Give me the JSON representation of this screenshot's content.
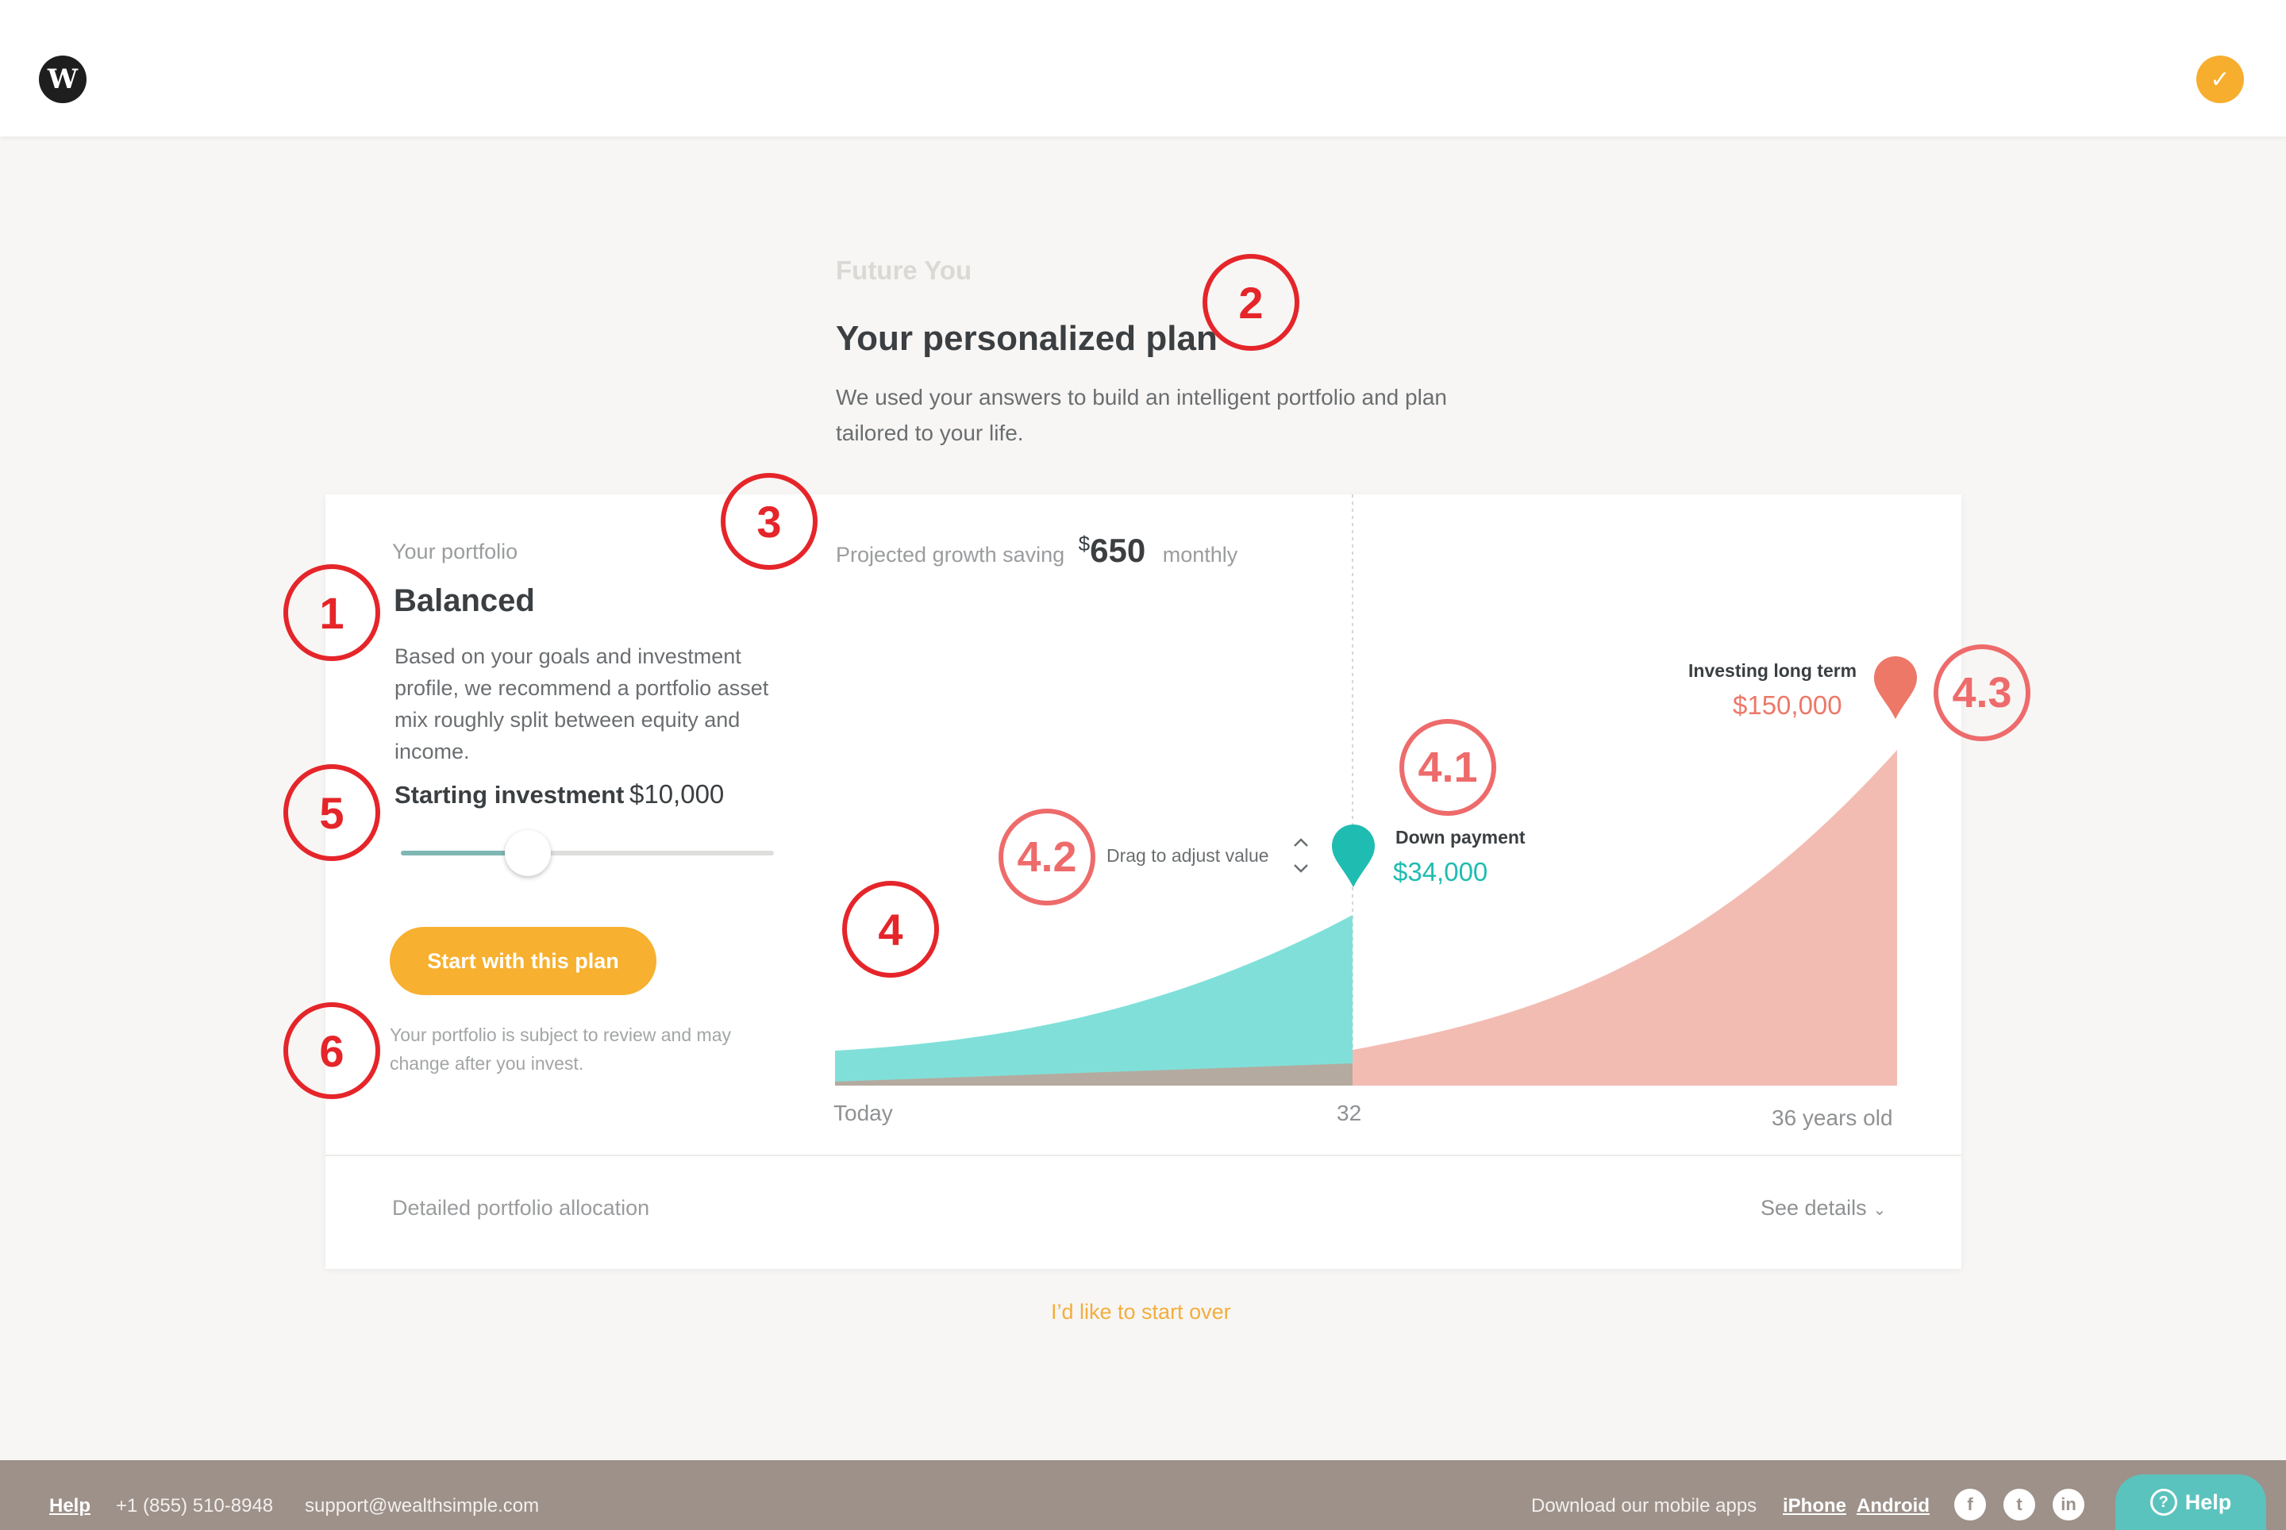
{
  "header": {
    "logo_letter": "W",
    "check_icon": "check-icon"
  },
  "intro": {
    "eyebrow": "Future You",
    "title": "Your personalized plan",
    "text": "We used your answers to build an intelligent portfolio and plan tailored to your life."
  },
  "portfolio": {
    "label": "Your portfolio",
    "name": "Balanced",
    "description": "Based on your goals and investment profile, we recommend a portfolio asset mix roughly split between equity and income.",
    "starting_label": "Starting investment",
    "starting_value": "$10,000",
    "slider_fraction": 0.34,
    "cta": "Start with this plan",
    "disclaimer": "Your portfolio is subject to review and may change after you invest."
  },
  "projection": {
    "prefix": "Projected growth saving",
    "currency": "$",
    "amount": "650",
    "suffix": "monthly",
    "drag_hint": "Drag to adjust value",
    "goal_long": {
      "label": "Investing long term",
      "value": "$150,000",
      "color": "#ed7868"
    },
    "goal_down": {
      "label": "Down payment",
      "value": "$34,000",
      "color": "#1fbcb1"
    },
    "x_labels": {
      "start": "Today",
      "mid": "32",
      "end": "36 years old"
    }
  },
  "allocation": {
    "label": "Detailed portfolio allocation",
    "link": "See details"
  },
  "start_over": "I’d like to start over",
  "annotations": {
    "a1": "1",
    "a2": "2",
    "a3": "3",
    "a4": "4",
    "a41": "4.1",
    "a42": "4.2",
    "a43": "4.3",
    "a5": "5",
    "a6": "6"
  },
  "footer": {
    "help": "Help",
    "phone": "+1 (855) 510-8948",
    "email": "support@wealthsimple.com",
    "download": "Download our mobile apps",
    "iphone": "iPhone",
    "android": "Android",
    "social": [
      "facebook-icon",
      "twitter-icon",
      "linkedin-icon"
    ],
    "help_button": "Help"
  },
  "colors": {
    "accent": "#f7b02f",
    "teal": "#1fbcb1",
    "coral": "#ed7868",
    "annotation": "#e5252a"
  }
}
